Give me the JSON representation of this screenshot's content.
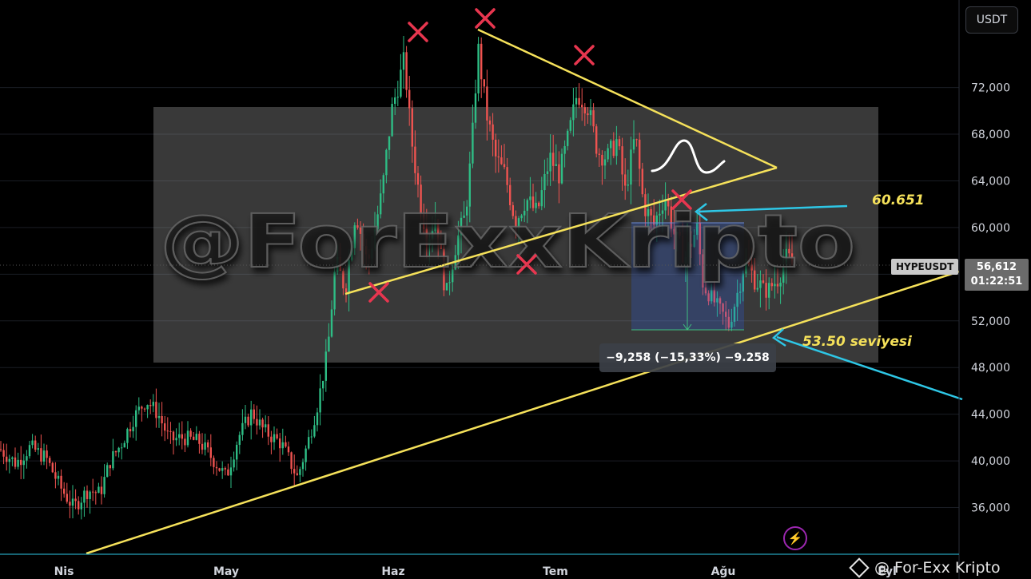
{
  "header": {
    "currency_button": "USDT"
  },
  "symbol_tag": "HYPEUSDT",
  "price_tag": {
    "price": "56,612",
    "countdown": "01:22:51"
  },
  "measure_label": "−9,258 (−15,33%) −9.258",
  "watermark": "@ForExxKripto",
  "brand_label": "@ For-Exx Kripto",
  "icons": {
    "brand": "diamond-logo-icon",
    "alert": "lightning-bolt-icon"
  },
  "chart_data": {
    "type": "candlestick",
    "y_ticks": [
      "72,000",
      "68,000",
      "64,000",
      "60,000",
      "56,000",
      "52,000",
      "48,000",
      "44,000",
      "40,000",
      "36,000"
    ],
    "x_ticks": [
      "Nis",
      "May",
      "Haz",
      "Tem",
      "Ağu",
      "Eyl"
    ],
    "ylim": [
      32000,
      79500
    ],
    "annotations": [
      {
        "label": "60.651",
        "price": 60651
      },
      {
        "label": "53.50 seviyesi",
        "price": 53500
      }
    ],
    "measure": {
      "from": 60651,
      "to": 51393,
      "change": -9258,
      "percent": -15.33
    },
    "last_price": 56612,
    "colors": {
      "up": "#2ebd85",
      "down": "#ef5350",
      "trendline": "#f5e15a",
      "arrow": "#2ec7e6",
      "cross": "#e8364f"
    }
  }
}
